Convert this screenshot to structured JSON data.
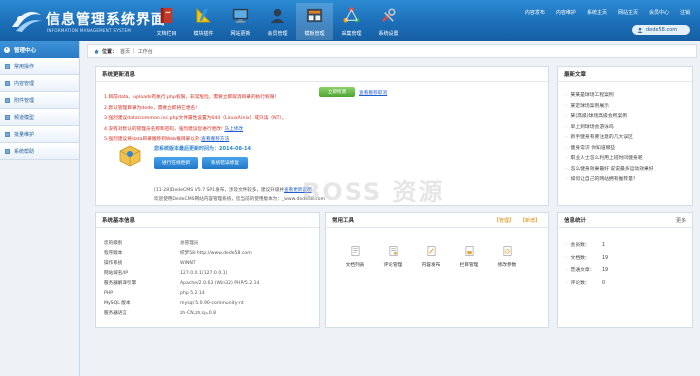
{
  "header": {
    "title": "信息管理系统界面",
    "subtitle": "INFORMATION MANAGEMENT SYSTEM",
    "nav": [
      {
        "label": "文档栏目",
        "icon": "book-icon"
      },
      {
        "label": "模块插件",
        "icon": "ruler-pencil-icon"
      },
      {
        "label": "网站更新",
        "icon": "monitor-icon"
      },
      {
        "label": "会员管理",
        "icon": "user-icon"
      },
      {
        "label": "模板管理",
        "icon": "template-icon"
      },
      {
        "label": "采集管理",
        "icon": "network-icon"
      },
      {
        "label": "系统设置",
        "icon": "tools-icon"
      }
    ],
    "top_links": [
      "内容发布",
      "内容维护",
      "系统主页",
      "网站主页",
      "会员中心",
      "注销"
    ],
    "user": "dede58.com"
  },
  "sidebar": {
    "heading": "管理中心",
    "items": [
      "常用操作",
      "内容管理",
      "附件管理",
      "频道模型",
      "批量维护",
      "系统帮助"
    ]
  },
  "breadcrumb": {
    "label": "位置：",
    "items": [
      "首页",
      "工作台"
    ]
  },
  "update_panel": {
    "title": "系统更新消息",
    "notices": [
      {
        "text": "1.目前data、uploads有执行.php权限，非常危险，需要立即取消目录的执行权限！",
        "link": ""
      },
      {
        "text": "2.默认管理目录为dede，需要立即将它更名!",
        "link": ""
      },
      {
        "text": "3.强烈建议data/common.inc.php文件属性设置为644（Linux/Unix）或只读（NT）。",
        "link": ""
      },
      {
        "text": "4.没有对默认的管理员名称和密码，强烈建议您进行更改!",
        "link": "马上修改"
      },
      {
        "text": "5.强烈建议将data目录搬移到Web根目录以外;",
        "link": "查看搬移方法"
      }
    ],
    "check_button": "立即检测",
    "cancel_link": "查看搬移取消",
    "version_text": "您系统版本最后更新时间为：2014-08-14",
    "online_update_button": "进行在线更新",
    "repair_button": "系统错误修复",
    "info_line1_prefix": "[11-28]DedeCMS V5.7 SP1发布，涉及文件较多，建议升级并",
    "info_line1_link": "查看更新说明",
    "info_line2": "欢迎使用DedeCMS网站内容管理系统，您当前的使用版本为：_www.dede58.com"
  },
  "news_panel": {
    "title": "最新文章",
    "items": [
      "某某是球场工程案例",
      "某定球场案例展示",
      "某(高级)球场高级会所案例",
      "早上到球场会游泳吗",
      "新手健身有要注意的几大误区",
      "健身常识 你知道哪些",
      "职业人士怎么利用上班时间健身呢",
      "怎么健身效果最好 说说最多运动效果好",
      "如何让自己的网站拥有推荐量？"
    ]
  },
  "sysinfo_panel": {
    "title": "系统基本信息",
    "rows": [
      {
        "k": "您的级别",
        "v": "总管理员"
      },
      {
        "k": "程序版本",
        "v": "织梦58-http://www.dede58.com"
      },
      {
        "k": "操作系统",
        "v": "WINNT"
      },
      {
        "k": "网站域名/IP",
        "v": "127.0.0.1(127.0.0.1)"
      },
      {
        "k": "服务器解译引擎",
        "v": "Apache/2.0.63 (Win32) PHP/5.2.14"
      },
      {
        "k": "PHP",
        "v": "php 5.2.14"
      },
      {
        "k": "MySQL 版本",
        "v": "mysql 5.0.90-community-nt"
      },
      {
        "k": "服务器语言",
        "v": "zh-CN,zh;q=0.8"
      }
    ]
  },
  "tools_panel": {
    "title": "常用工具",
    "links": [
      "【管理】",
      "【新增】"
    ],
    "tools": [
      "文档列表",
      "评论管理",
      "内容发布",
      "栏目管理",
      "修改参数"
    ]
  },
  "stats_panel": {
    "title": "信息统计",
    "more": "更多",
    "rows": [
      {
        "k": "会员数：",
        "v": "1"
      },
      {
        "k": "文档数：",
        "v": "19"
      },
      {
        "k": "普通文章：",
        "v": "19"
      },
      {
        "k": "评论数：",
        "v": "0"
      }
    ]
  },
  "watermark": "BOSS 资源"
}
